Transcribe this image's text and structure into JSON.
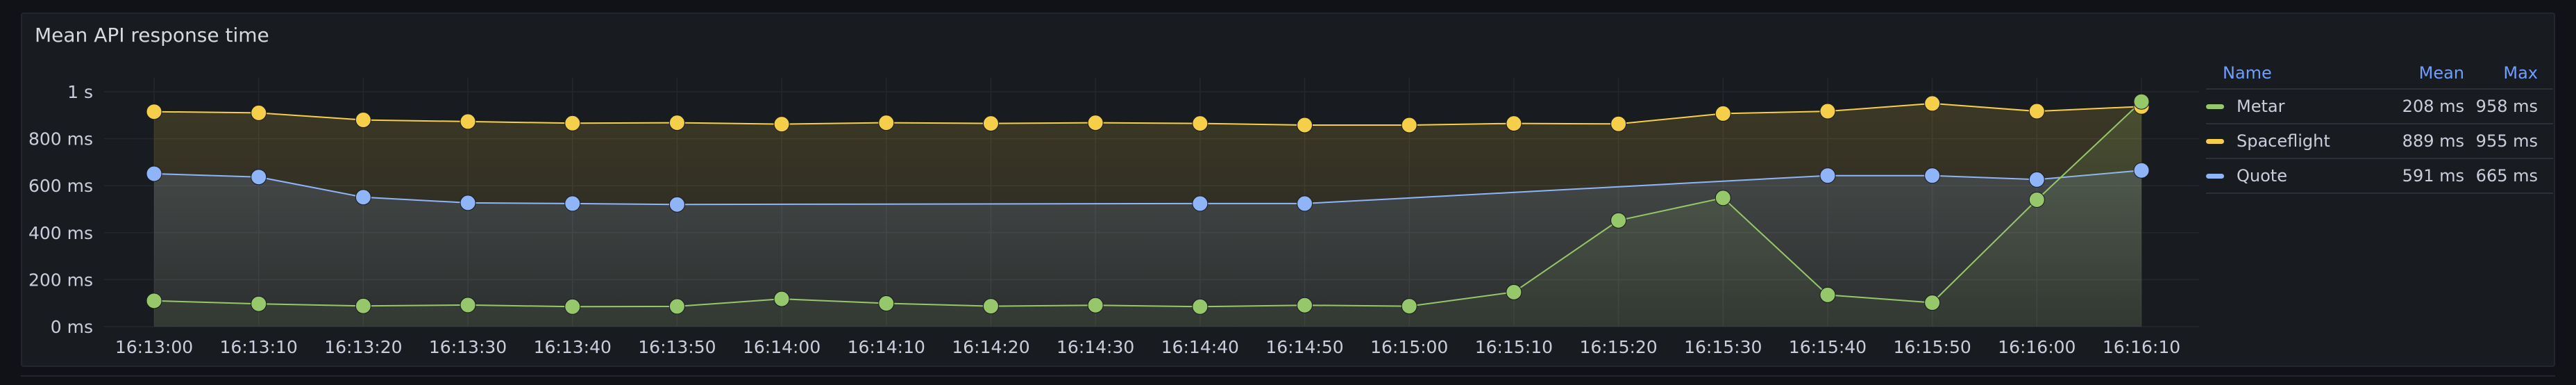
{
  "panel": {
    "title": "Mean API response time"
  },
  "legend": {
    "headers": {
      "name": "Name",
      "mean": "Mean",
      "max": "Max"
    },
    "rows": [
      {
        "name": "Metar",
        "mean": "208 ms",
        "max": "958 ms",
        "color": "#96c76b"
      },
      {
        "name": "Spaceflight",
        "mean": "889 ms",
        "max": "955 ms",
        "color": "#f5cf4a"
      },
      {
        "name": "Quote",
        "mean": "591 ms",
        "max": "665 ms",
        "color": "#8fb4f8"
      }
    ]
  },
  "chart_data": {
    "type": "line",
    "title": "Mean API response time",
    "x": [
      "16:13:00",
      "16:13:10",
      "16:13:20",
      "16:13:30",
      "16:13:40",
      "16:13:50",
      "16:14:00",
      "16:14:10",
      "16:14:20",
      "16:14:30",
      "16:14:40",
      "16:14:50",
      "16:15:00",
      "16:15:10",
      "16:15:20",
      "16:15:30",
      "16:15:40",
      "16:15:50",
      "16:16:00",
      "16:16:10"
    ],
    "y_ticks": [
      "0 ms",
      "200 ms",
      "400 ms",
      "600 ms",
      "800 ms",
      "1 s"
    ],
    "ylim": [
      0,
      1000
    ],
    "grid": true,
    "legend_position": "right",
    "series": [
      {
        "name": "Spaceflight",
        "color": "#f5cf4a",
        "values": [
          915,
          910,
          880,
          873,
          866,
          868,
          862,
          868,
          865,
          868,
          865,
          858,
          858,
          865,
          863,
          907,
          917,
          950,
          917,
          937
        ]
      },
      {
        "name": "Quote",
        "color": "#8fb4f8",
        "values": [
          651,
          637,
          551,
          527,
          524,
          520,
          null,
          null,
          null,
          null,
          524,
          524,
          null,
          null,
          null,
          null,
          643,
          643,
          626,
          665
        ]
      },
      {
        "name": "Metar",
        "color": "#96c76b",
        "values": [
          110,
          97,
          88,
          92,
          85,
          86,
          118,
          99,
          87,
          91,
          85,
          91,
          87,
          147,
          452,
          548,
          135,
          102,
          540,
          958
        ]
      }
    ]
  }
}
